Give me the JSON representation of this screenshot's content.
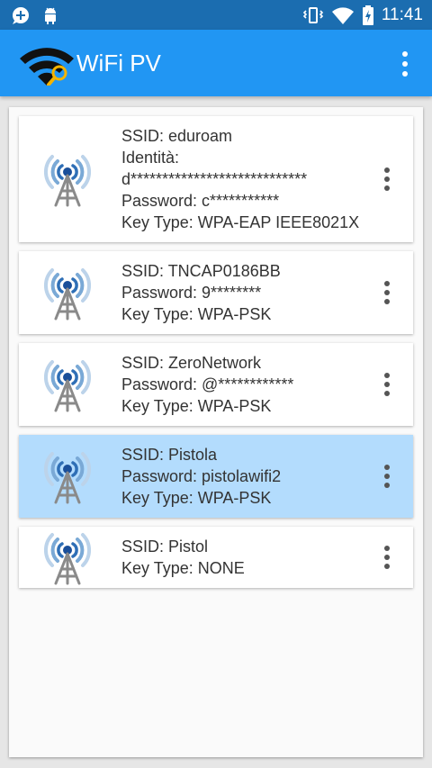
{
  "status_bar": {
    "time": "11:41",
    "left_icons": [
      "chat-plus-icon",
      "android-icon"
    ],
    "right_icons": [
      "vibrate-icon",
      "wifi-signal-icon",
      "battery-charging-icon"
    ]
  },
  "app_bar": {
    "title": "WiFi PV",
    "logo_icon": "wifi-search-logo-icon",
    "menu_icon": "overflow-menu-icon",
    "color": "#2196f3"
  },
  "networks": [
    {
      "ssid": "SSID: eduroam",
      "lines": [
        "Identità:",
        "d****************************",
        "Password: c***********",
        "Key Type: WPA-EAP IEEE8021X"
      ],
      "selected": false
    },
    {
      "ssid": "SSID: TNCAP0186BB",
      "lines": [
        "Password: 9********",
        "Key Type: WPA-PSK"
      ],
      "selected": false
    },
    {
      "ssid": "SSID: ZeroNetwork",
      "lines": [
        "Password: @************",
        "Key Type: WPA-PSK"
      ],
      "selected": false
    },
    {
      "ssid": "SSID: Pistola",
      "lines": [
        "Password: pistolawifi2",
        "Key Type: WPA-PSK"
      ],
      "selected": true
    },
    {
      "ssid": "SSID: Pistol",
      "lines": [
        "Key Type: NONE"
      ],
      "selected": false
    }
  ]
}
